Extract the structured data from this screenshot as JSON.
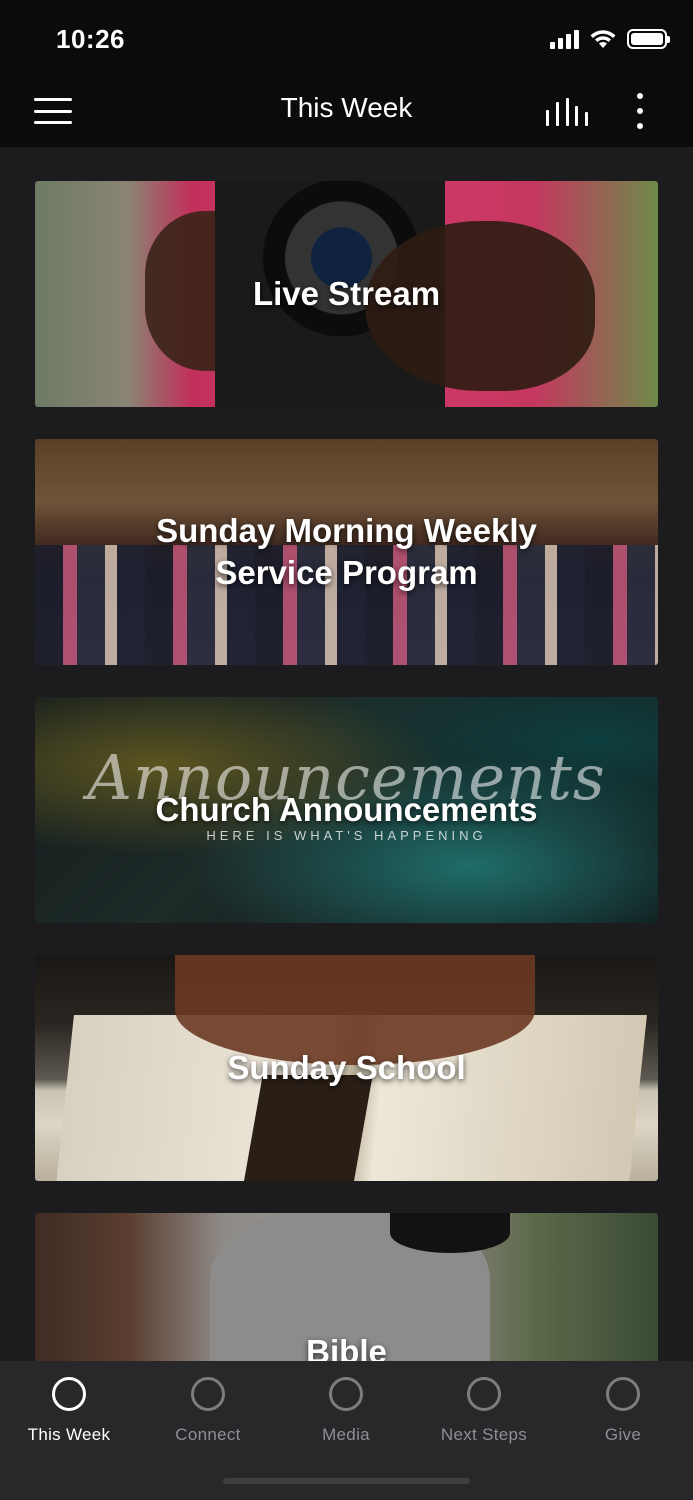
{
  "status_bar": {
    "time": "10:26"
  },
  "header": {
    "title": "This Week",
    "menu_icon": "hamburger-icon",
    "audio_icon": "audio-bars-icon",
    "more_icon": "more-vertical-icon"
  },
  "cards": [
    {
      "title": "Live Stream"
    },
    {
      "title": "Sunday Morning Weekly Service Program"
    },
    {
      "title": "Church Announcements",
      "image_script": "Announcements",
      "image_subtitle": "HERE IS WHAT'S HAPPENING"
    },
    {
      "title": "Sunday School"
    },
    {
      "title": "Bible"
    }
  ],
  "tabs": [
    {
      "label": "This Week",
      "active": true
    },
    {
      "label": "Connect",
      "active": false
    },
    {
      "label": "Media",
      "active": false
    },
    {
      "label": "Next Steps",
      "active": false
    },
    {
      "label": "Give",
      "active": false
    }
  ],
  "colors": {
    "background": "#1c1c1e",
    "header": "#0b0b0c",
    "tabbar": "#28282a",
    "tab_active": "#ffffff",
    "tab_inactive": "#8e8e93"
  }
}
